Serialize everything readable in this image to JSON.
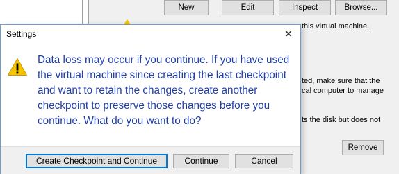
{
  "background": {
    "buttons": {
      "new": "New",
      "edit": "Edit",
      "inspect": "Inspect",
      "browse": "Browse..."
    },
    "text_line_1": "this virtual machine.",
    "text_line_2": "ted, make sure that the",
    "text_line_3": "cal computer to manage",
    "text_line_4": "ts the disk but does not",
    "remove_button": "Remove"
  },
  "dialog": {
    "title": "Settings",
    "close_glyph": "✕",
    "icon": "warning-icon",
    "message_lines": [
      "Data loss may occur if you continue. If you have used",
      "the virtual machine since creating the last checkpoint",
      "and want to retain the changes, create another",
      "checkpoint to preserve those changes before you",
      "continue. What do you want to do?"
    ],
    "buttons": {
      "create_checkpoint": "Create Checkpoint and Continue",
      "continue": "Continue",
      "cancel": "Cancel"
    }
  },
  "colors": {
    "message_text": "#1f3ea8",
    "warning_yellow": "#f5c400",
    "focus_border": "#0078d7"
  }
}
